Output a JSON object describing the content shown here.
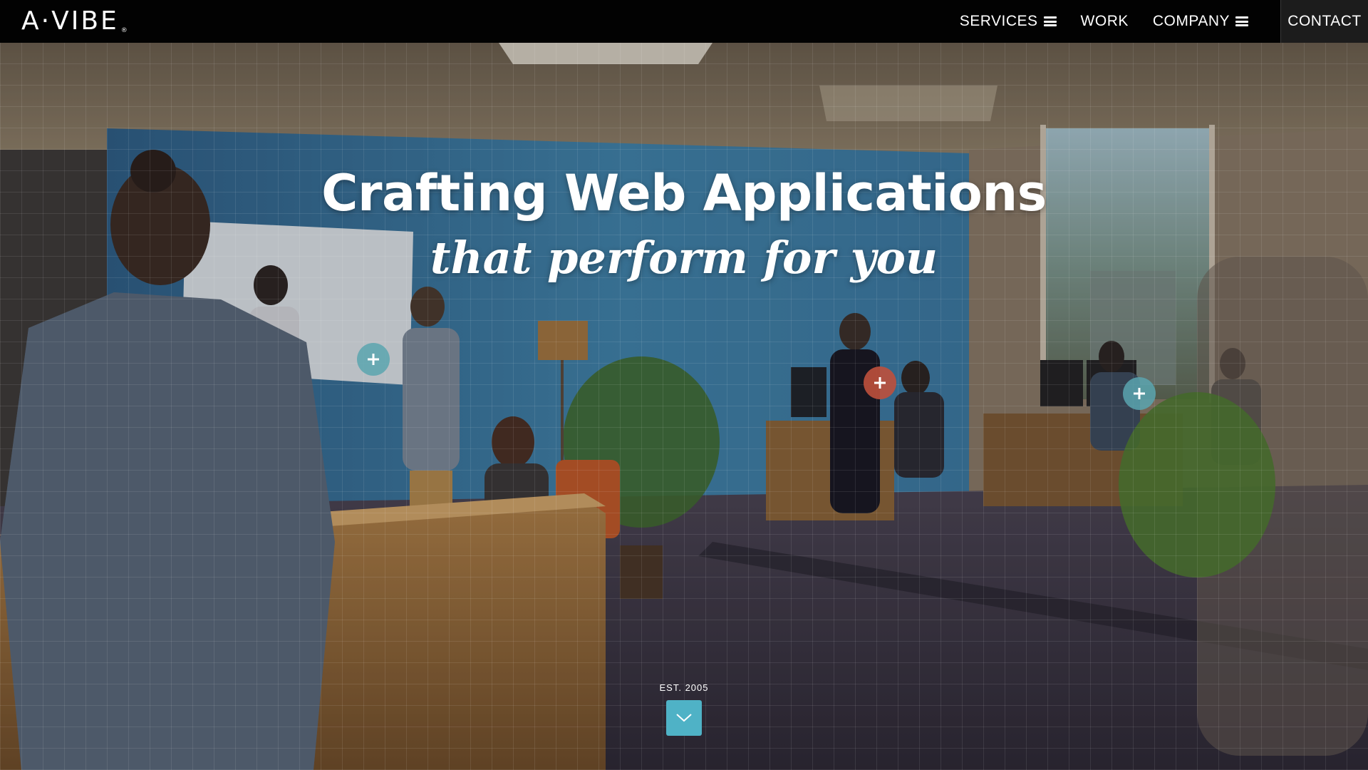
{
  "brand": {
    "logo_text": "A·VIBE",
    "logo_mark": "®"
  },
  "nav": {
    "services": "SERVICES",
    "work": "WORK",
    "company": "COMPANY",
    "contact": "CONTACT"
  },
  "hero": {
    "headline": "Crafting Web Applications",
    "subheadline": "that perform for you",
    "established": "EST. 2005"
  },
  "colors": {
    "header_bg": "#020202",
    "scroll_button": "#4fb2c6",
    "hotspot_teal": "#5aa5af",
    "hotspot_red": "#be503c",
    "wall_blue": "#3f7fa6"
  },
  "icons": {
    "menu": "hamburger-icon",
    "hotspot": "plus-icon",
    "scroll": "chevron-down-icon"
  }
}
